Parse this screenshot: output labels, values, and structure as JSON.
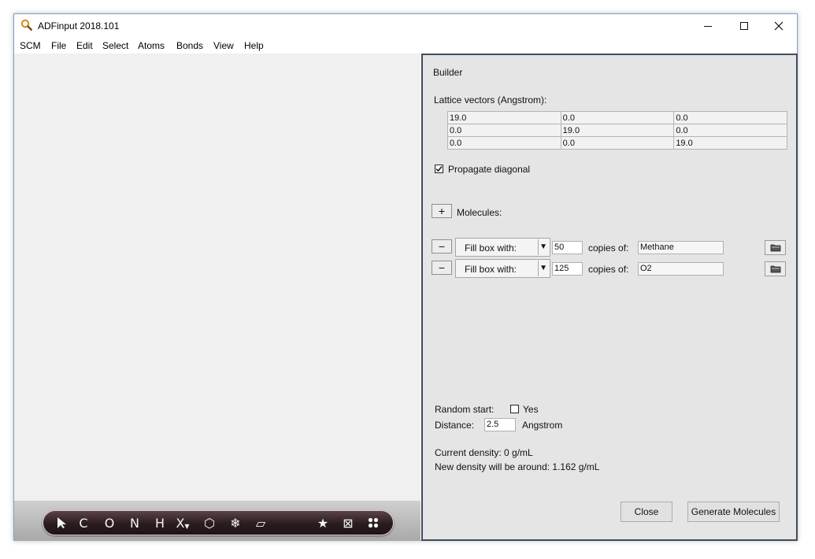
{
  "window": {
    "title": "ADFinput 2018.101"
  },
  "menubar": [
    "SCM",
    "File",
    "Edit",
    "Select",
    "Atoms",
    "Bonds",
    "View",
    "Help"
  ],
  "toolbar": {
    "items": [
      {
        "name": "select-tool-icon",
        "glyph": ""
      },
      {
        "name": "carbon-tool",
        "glyph": "C"
      },
      {
        "name": "oxygen-tool",
        "glyph": "O"
      },
      {
        "name": "nitrogen-tool",
        "glyph": "N"
      },
      {
        "name": "hydrogen-tool",
        "glyph": "H"
      },
      {
        "name": "other-element-tool",
        "glyph": "X"
      },
      {
        "name": "ring-icon",
        "glyph": "⬡"
      },
      {
        "name": "snowflake-icon",
        "glyph": "❄"
      },
      {
        "name": "plane-icon",
        "glyph": "▱"
      },
      {
        "name": "star-icon",
        "glyph": "★"
      },
      {
        "name": "box-icon",
        "glyph": "⊠"
      },
      {
        "name": "molecules-icon",
        "glyph": "⁘"
      }
    ]
  },
  "builder": {
    "title": "Builder",
    "lattice_label": "Lattice vectors (Angstrom):",
    "lattice": [
      [
        "19.0",
        "0.0",
        "0.0"
      ],
      [
        "0.0",
        "19.0",
        "0.0"
      ],
      [
        "0.0",
        "0.0",
        "19.0"
      ]
    ],
    "propagate_label": "Propagate diagonal",
    "propagate_checked": true,
    "add_symbol": "+",
    "molecules_label": "Molecules:",
    "rows": [
      {
        "remove_symbol": "−",
        "mode": "Fill box with:",
        "count": "50",
        "copies_label": "copies of:",
        "molecule": "Methane"
      },
      {
        "remove_symbol": "−",
        "mode": "Fill box with:",
        "count": "125",
        "copies_label": "copies of:",
        "molecule": "O2"
      }
    ],
    "random_start_label": "Random start:",
    "random_start_yes": "Yes",
    "random_start_checked": false,
    "distance_label": "Distance:",
    "distance_value": "2.5",
    "distance_unit": "Angstrom",
    "current_density": "Current density: 0 g/mL",
    "new_density": "New density will be around: 1.162 g/mL",
    "close_label": "Close",
    "generate_label": "Generate Molecules"
  }
}
